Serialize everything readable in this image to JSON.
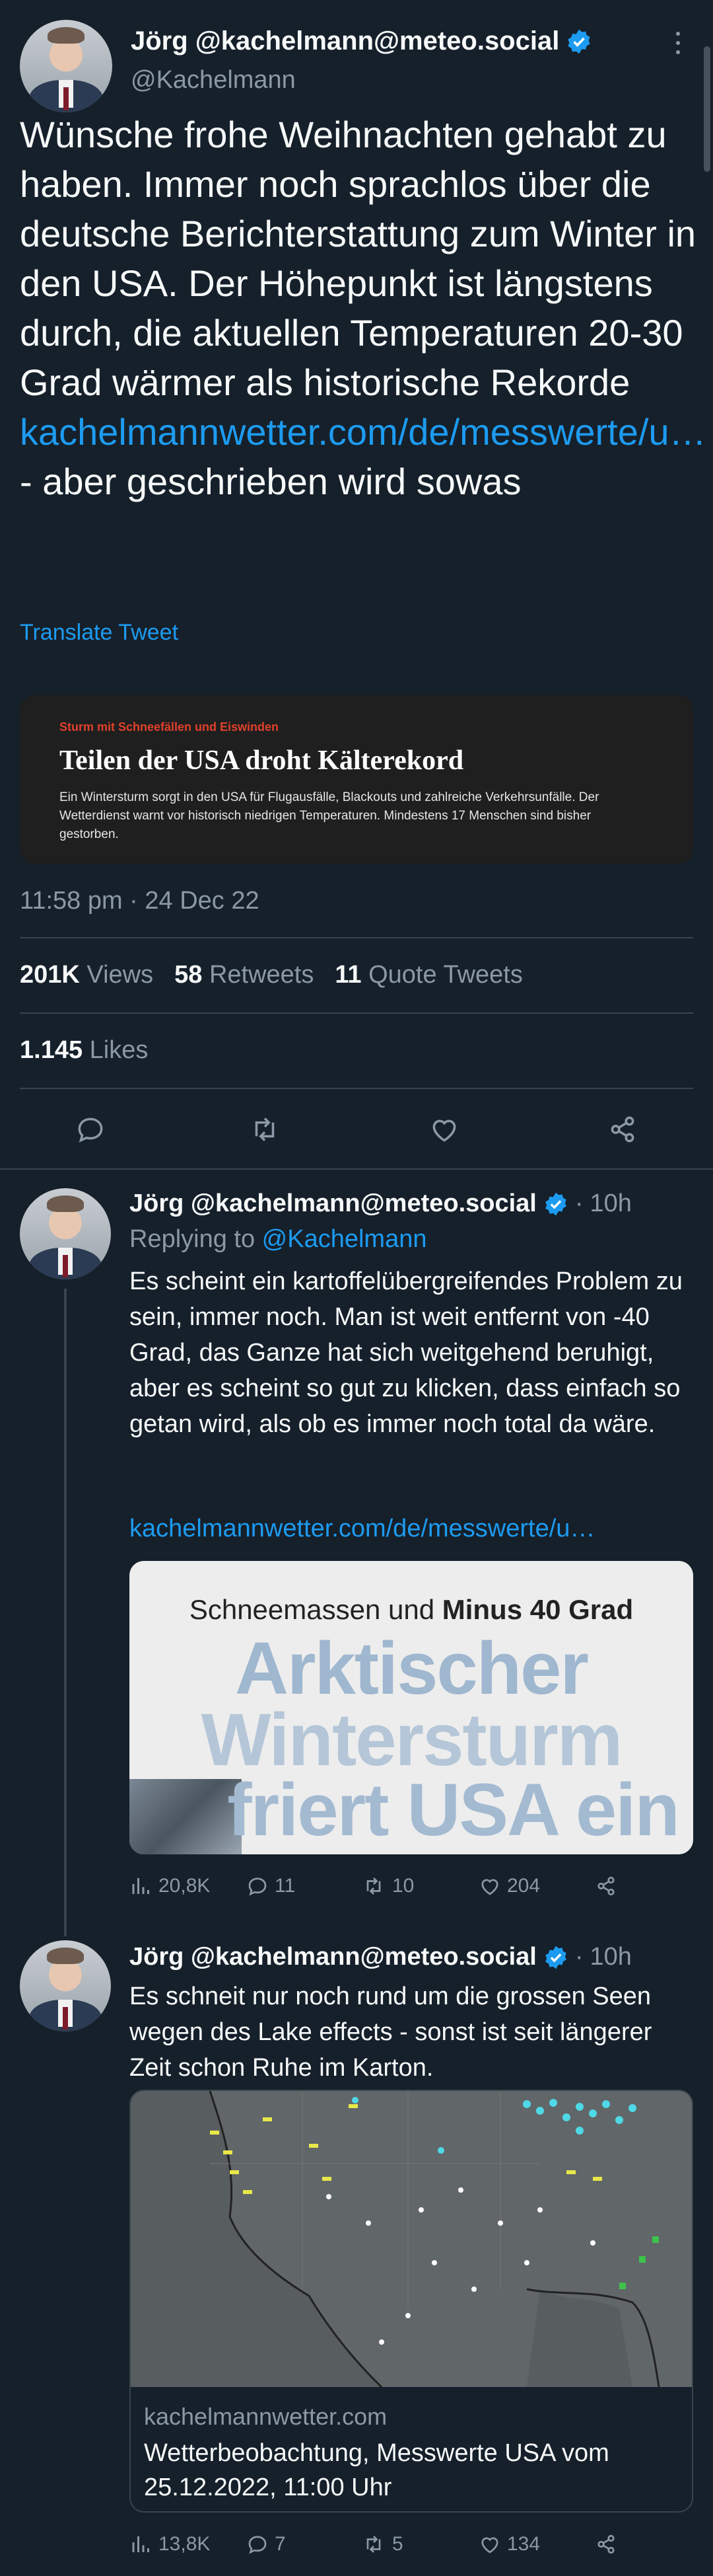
{
  "main_tweet": {
    "display_name": "Jörg @kachelmann@meteo.social",
    "handle": "@Kachelmann",
    "text_part1": "Wünsche frohe Weihnachten gehabt zu haben. Immer noch sprachlos über die deutsche Berichterstattung zum Winter in den USA. Der Höhepunkt ist längstens durch, die aktuellen Temperaturen 20-30 Grad wärmer als historische Rekorde ",
    "link": "kachelmannwetter.com/de/messwerte/u…",
    "text_part2": " - aber geschrieben wird sowas",
    "translate": "Translate Tweet",
    "card": {
      "kicker": "Sturm mit Schneefällen und Eiswinden",
      "headline": "Teilen der USA droht Kälterekord",
      "body": "Ein Wintersturm sorgt in den USA für Flugausfälle, Blackouts und zahlreiche Verkehrsunfälle. Der Wetterdienst warnt vor historisch niedrigen Temperaturen. Mindestens 17 Menschen sind bisher gestorben."
    },
    "timestamp": "11:58 pm · 24 Dec 22",
    "stats": {
      "views_num": "201K",
      "views_label": "Views",
      "retweets_num": "58",
      "retweets_label": "Retweets",
      "quotes_num": "11",
      "quotes_label": "Quote Tweets",
      "likes_num": "1.145",
      "likes_label": "Likes"
    }
  },
  "reply1": {
    "display_name": "Jörg @kachelmann@meteo.social",
    "time": "10h",
    "replying_prefix": "Replying to ",
    "replying_handle": "@Kachelmann",
    "text": "Es scheint ein kartoffelübergreifendes Problem zu sein, immer noch. Man ist weit entfernt von -40 Grad, das Ganze hat sich weitgehend beruhigt, aber es scheint so gut zu klicken, dass einfach so getan wird, als ob es immer noch total da wäre.",
    "link": "kachelmannwetter.com/de/messwerte/u…",
    "image": {
      "top_line_a": "Schneemassen und ",
      "top_line_b": "Minus 40 Grad",
      "line1": "Arktischer",
      "line2": "Wintersturm",
      "line3": "friert USA ein"
    },
    "views": "20,8K",
    "replies": "11",
    "retweets": "10",
    "likes": "204"
  },
  "reply2": {
    "display_name": "Jörg @kachelmann@meteo.social",
    "time": "10h",
    "text": "Es schneit nur noch rund um die grossen Seen wegen des Lake effects - sonst ist seit längerer Zeit schon Ruhe im Karton.",
    "card_domain": "kachelmannwetter.com",
    "card_title": "Wetterbeobachtung, Messwerte USA vom 25.12.2022, 11:00 Uhr",
    "views": "13,8K",
    "replies": "7",
    "retweets": "5",
    "likes": "134"
  },
  "colors": {
    "background": "#15202b",
    "accent": "#1d9bf0",
    "muted": "#8b98a5",
    "divider": "#38444d"
  }
}
